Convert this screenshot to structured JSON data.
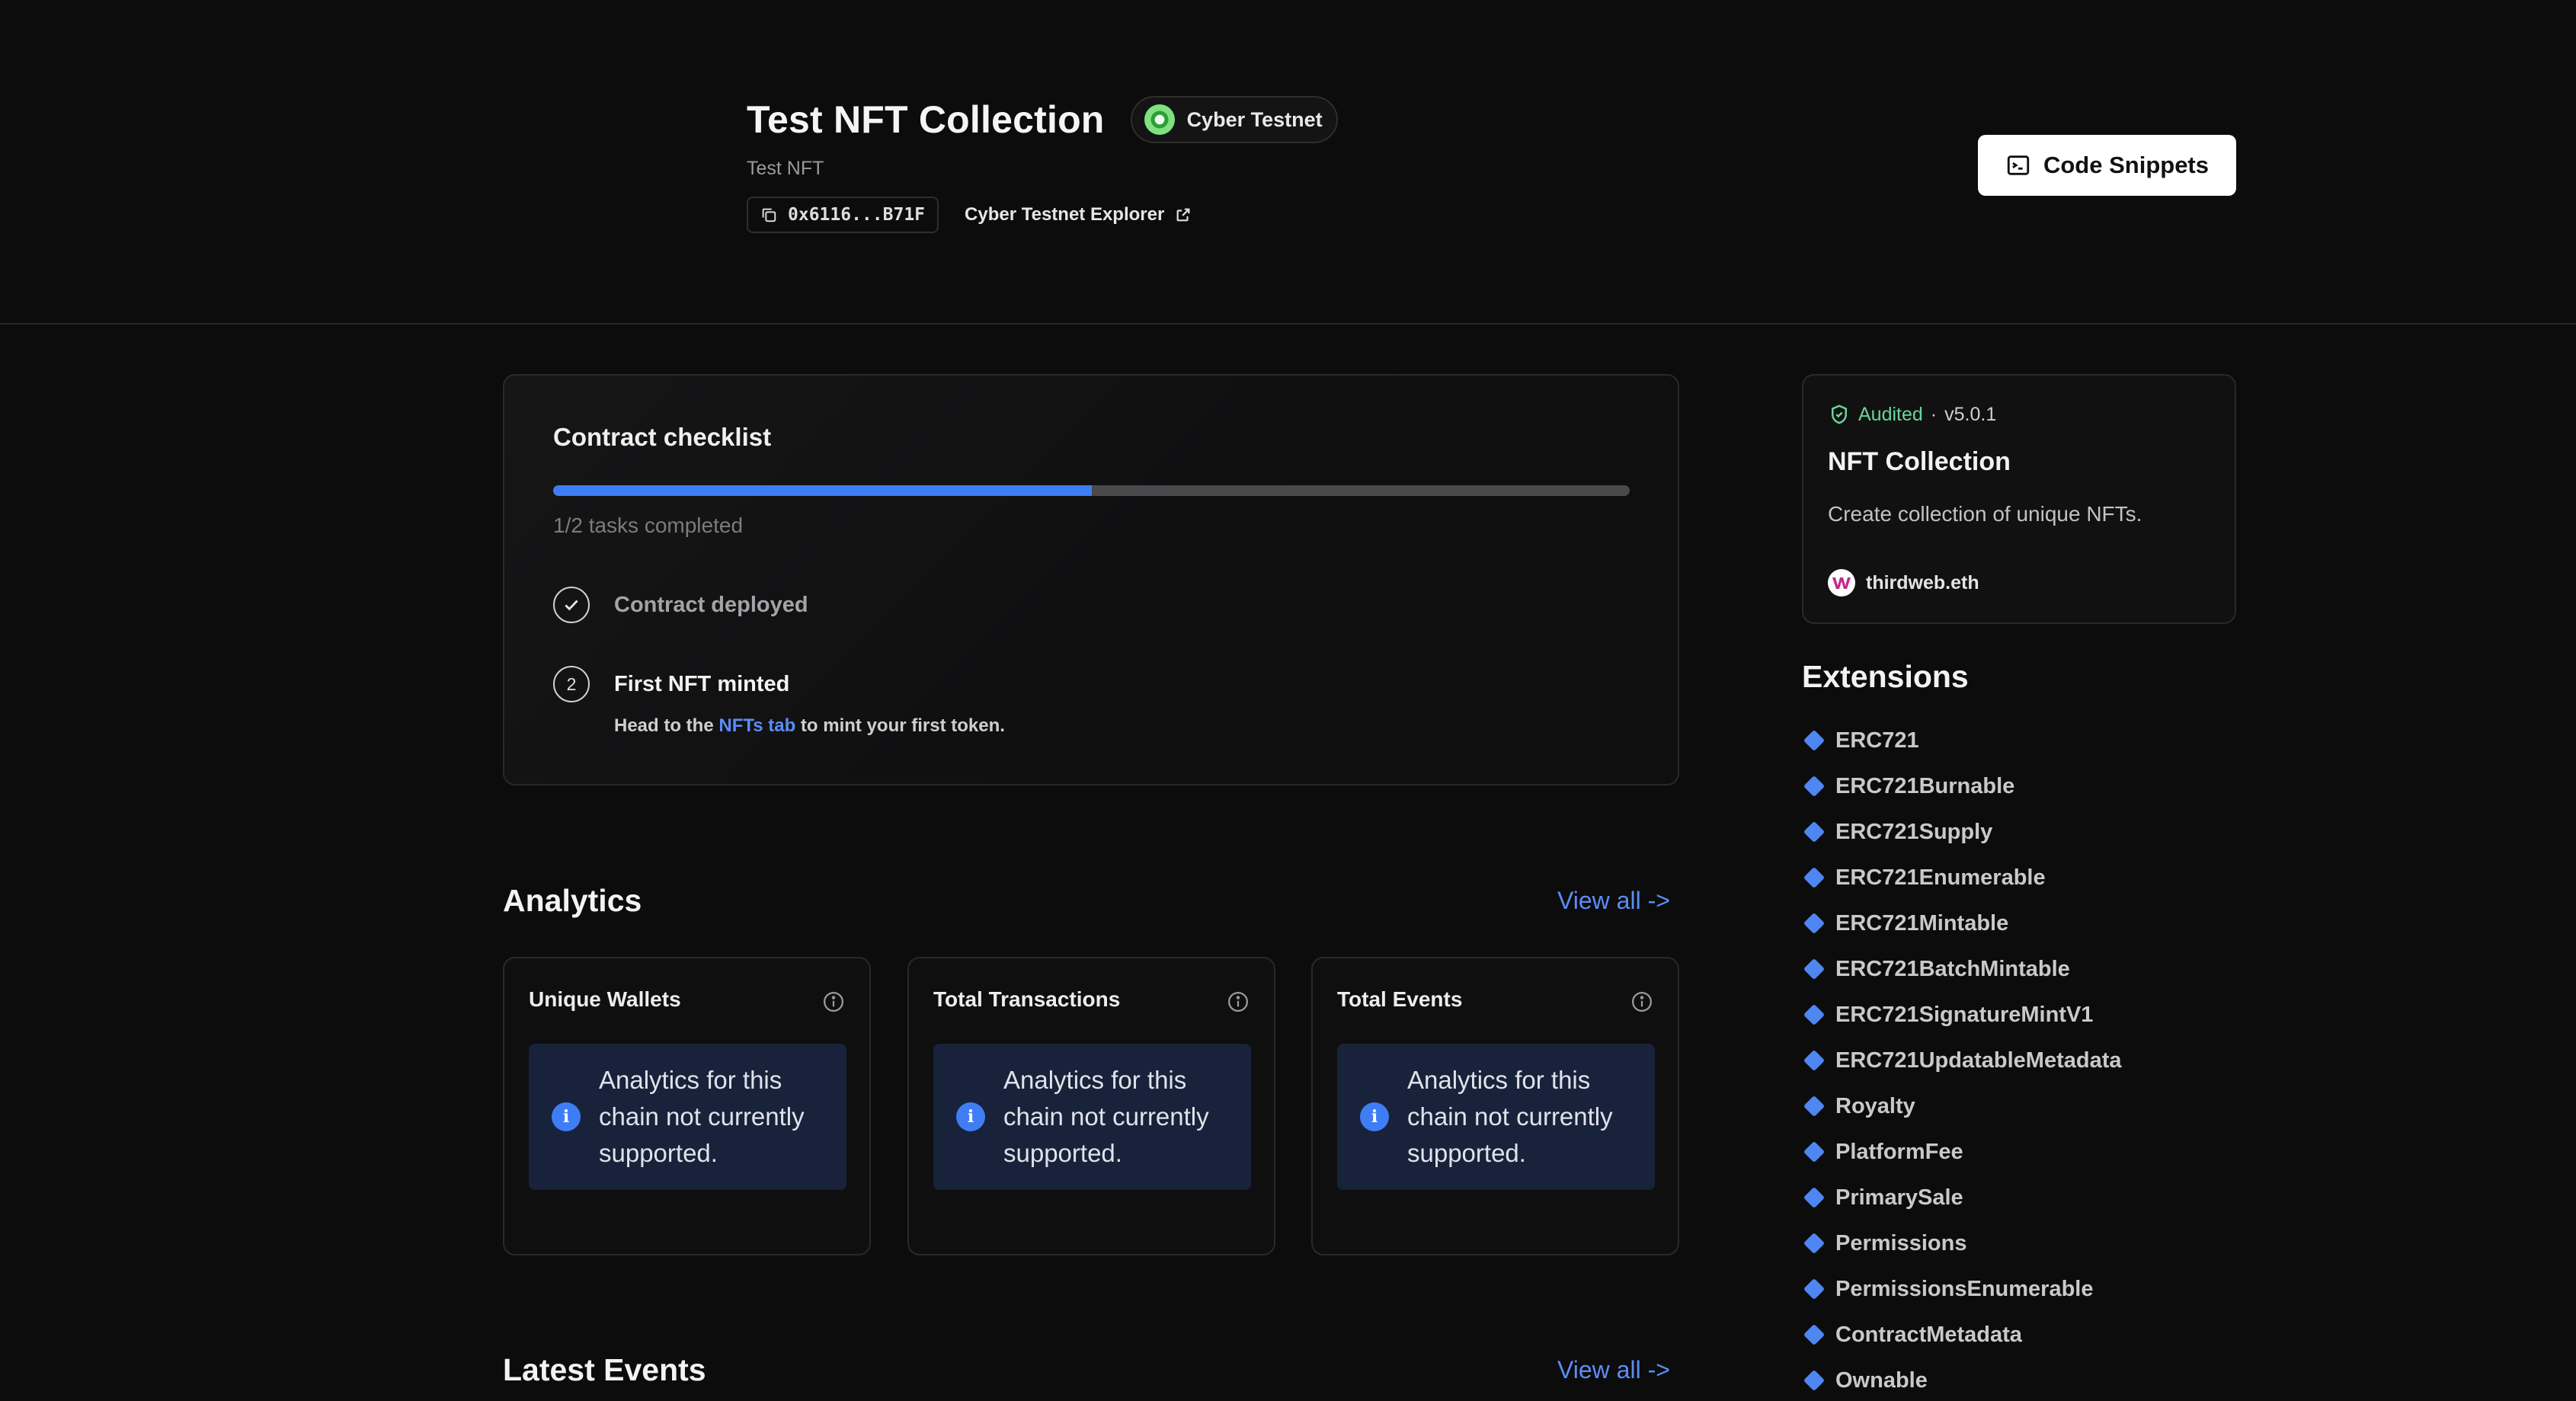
{
  "header": {
    "title": "Test NFT Collection",
    "subtitle": "Test NFT",
    "chain_badge": "Cyber Testnet",
    "address": "0x6116...B71F",
    "explorer_label": "Cyber Testnet Explorer",
    "code_snippets_label": "Code Snippets"
  },
  "checklist": {
    "title": "Contract checklist",
    "progress_fraction": 0.5,
    "tasks_completed": "1/2 tasks completed",
    "steps": [
      {
        "label": "Contract deployed",
        "done": true
      },
      {
        "number": "2",
        "label": "First NFT minted",
        "done": false,
        "hint_prefix": "Head to the",
        "hint_link": "NFTs tab",
        "hint_suffix": "to mint your first token."
      }
    ]
  },
  "analytics": {
    "title": "Analytics",
    "view_all": "View all ->",
    "cards": [
      {
        "title": "Unique Wallets",
        "notice": "Analytics for this chain not currently supported."
      },
      {
        "title": "Total Transactions",
        "notice": "Analytics for this chain not currently supported."
      },
      {
        "title": "Total Events",
        "notice": "Analytics for this chain not currently supported."
      }
    ]
  },
  "latest_events": {
    "title": "Latest Events",
    "view_all": "View all ->"
  },
  "contract": {
    "audited": "Audited",
    "version": "v5.0.1",
    "name": "NFT Collection",
    "description": "Create collection of unique NFTs.",
    "publisher": "thirdweb.eth"
  },
  "extensions": {
    "title": "Extensions",
    "items": [
      "ERC721",
      "ERC721Burnable",
      "ERC721Supply",
      "ERC721Enumerable",
      "ERC721Mintable",
      "ERC721BatchMintable",
      "ERC721SignatureMintV1",
      "ERC721UpdatableMetadata",
      "Royalty",
      "PlatformFee",
      "PrimarySale",
      "Permissions",
      "PermissionsEnumerable",
      "ContractMetadata",
      "Ownable"
    ]
  },
  "colors": {
    "accent": "#3f7df5",
    "link": "#5b8df7",
    "audited": "#6ad49a",
    "background": "#0c0c0d"
  },
  "icons": [
    "copy-icon",
    "external-link-icon",
    "terminal-icon",
    "check-icon",
    "info-icon",
    "shield-icon",
    "diamond-icon"
  ]
}
